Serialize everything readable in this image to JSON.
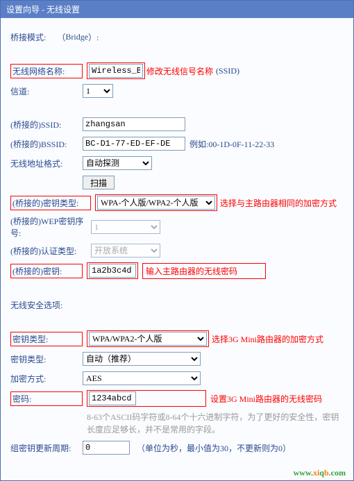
{
  "title": "设置向导 - 无线设置",
  "bridge": {
    "label": "桥接模式:",
    "paren_l": "（",
    "bridge_en": "Bridge",
    "paren_r": "）:"
  },
  "ssid": {
    "label": "无线网络名称:",
    "value": "Wireless_B",
    "annot": "修改无线信号名称",
    "suffix": "(SSID)"
  },
  "channel": {
    "label": "信道:",
    "value": "1"
  },
  "bssid": {
    "label": "(桥接的)SSID:",
    "value": "zhangsan"
  },
  "bssid2": {
    "label": "(桥接的)BSSID:",
    "value": "BC-D1-77-ED-EF-DE",
    "example": "例如:00-1D-0F-11-22-33"
  },
  "addrfmt": {
    "label": "无线地址格式:",
    "value": "自动探测"
  },
  "scan": {
    "btn": "扫描"
  },
  "keytype": {
    "label": "(桥接的)密钥类型:",
    "value": "WPA-个人版/WPA2-个人版",
    "annot": "选择与主路由器相同的加密方式"
  },
  "wepidx": {
    "label": "(桥接的)WEP密钥序号:",
    "value": "1"
  },
  "auth": {
    "label": "(桥接的)认证类型:",
    "value": "开放系统"
  },
  "key": {
    "label": "(桥接的)密钥:",
    "value": "1a2b3c4d",
    "annot": "输入主路由器的无线密码"
  },
  "sec": {
    "label": "无线安全选项:"
  },
  "kt2": {
    "label": "密钥类型:",
    "value": "WPA/WPA2-个人版",
    "annot": "选择3G Mini路由器的加密方式"
  },
  "kt3": {
    "label": "密钥类型:",
    "value": "自动（推荐）"
  },
  "enc": {
    "label": "加密方式:",
    "value": "AES"
  },
  "pwd": {
    "label": "密码:",
    "value": "1234abcd",
    "annot": "设置3G Mini路由器的无线密码"
  },
  "help": "8-63个ASCII码字符或8-64个十六进制字符，为了更好的安全性，密钥长度应足够长，并不是常用的字段。",
  "rekey": {
    "label": "组密钥更新周期:",
    "value": "0",
    "suffix": "（单位为秒，最小值为30，不更新则为0）"
  },
  "footer": {
    "w": "www.",
    "x": "xi",
    "q": "q",
    "b": "b",
    "dot": ".",
    "com": "com"
  }
}
